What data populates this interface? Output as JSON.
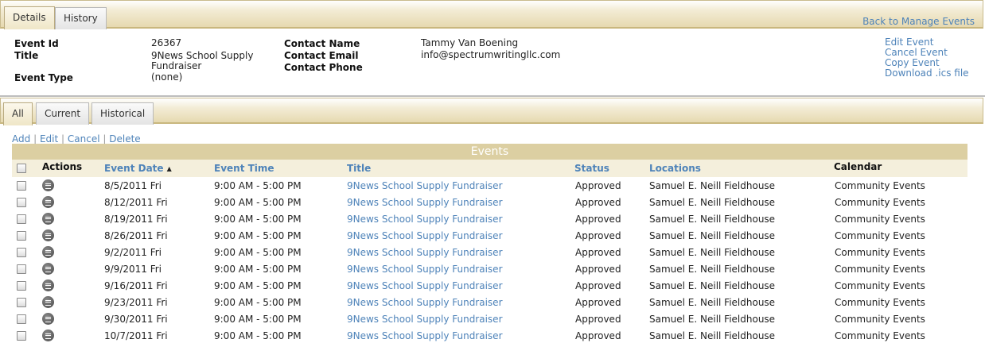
{
  "top_tabs": [
    {
      "label": "Details",
      "active": true
    },
    {
      "label": "History",
      "active": false
    }
  ],
  "back_link": "Back to Manage Events",
  "details": {
    "event_id_label": "Event Id",
    "event_id": "26367",
    "title_label": "Title",
    "title_line1": "9News School Supply",
    "title_line2": "Fundraiser",
    "event_type_label": "Event Type",
    "event_type": "(none)",
    "contact_name_label": "Contact Name",
    "contact_name": "Tammy Van Boening",
    "contact_email_label": "Contact Email",
    "contact_email": "info@spectrumwritingllc.com",
    "contact_phone_label": "Contact Phone",
    "contact_phone": ""
  },
  "side_links": [
    "Edit Event",
    "Cancel Event",
    "Copy Event",
    "Download .ics file"
  ],
  "list_tabs": [
    {
      "label": "All",
      "active": true
    },
    {
      "label": "Current",
      "active": false
    },
    {
      "label": "Historical",
      "active": false
    }
  ],
  "grid_actions": {
    "add": "Add",
    "edit": "Edit",
    "cancel": "Cancel",
    "delete": "Delete",
    "separator": "|"
  },
  "grid": {
    "title": "Events",
    "headers": {
      "actions": "Actions",
      "event_date": "Event Date",
      "event_time": "Event Time",
      "title": "Title",
      "status": "Status",
      "locations": "Locations",
      "calendar": "Calendar"
    },
    "sort_indicator": "▲",
    "rows": [
      {
        "date": "8/5/2011 Fri",
        "time": "9:00 AM - 5:00 PM",
        "title": "9News School Supply Fundraiser",
        "status": "Approved",
        "location": "Samuel E. Neill Fieldhouse",
        "calendar": "Community Events"
      },
      {
        "date": "8/12/2011 Fri",
        "time": "9:00 AM - 5:00 PM",
        "title": "9News School Supply Fundraiser",
        "status": "Approved",
        "location": "Samuel E. Neill Fieldhouse",
        "calendar": "Community Events"
      },
      {
        "date": "8/19/2011 Fri",
        "time": "9:00 AM - 5:00 PM",
        "title": "9News School Supply Fundraiser",
        "status": "Approved",
        "location": "Samuel E. Neill Fieldhouse",
        "calendar": "Community Events"
      },
      {
        "date": "8/26/2011 Fri",
        "time": "9:00 AM - 5:00 PM",
        "title": "9News School Supply Fundraiser",
        "status": "Approved",
        "location": "Samuel E. Neill Fieldhouse",
        "calendar": "Community Events"
      },
      {
        "date": "9/2/2011 Fri",
        "time": "9:00 AM - 5:00 PM",
        "title": "9News School Supply Fundraiser",
        "status": "Approved",
        "location": "Samuel E. Neill Fieldhouse",
        "calendar": "Community Events"
      },
      {
        "date": "9/9/2011 Fri",
        "time": "9:00 AM - 5:00 PM",
        "title": "9News School Supply Fundraiser",
        "status": "Approved",
        "location": "Samuel E. Neill Fieldhouse",
        "calendar": "Community Events"
      },
      {
        "date": "9/16/2011 Fri",
        "time": "9:00 AM - 5:00 PM",
        "title": "9News School Supply Fundraiser",
        "status": "Approved",
        "location": "Samuel E. Neill Fieldhouse",
        "calendar": "Community Events"
      },
      {
        "date": "9/23/2011 Fri",
        "time": "9:00 AM - 5:00 PM",
        "title": "9News School Supply Fundraiser",
        "status": "Approved",
        "location": "Samuel E. Neill Fieldhouse",
        "calendar": "Community Events"
      },
      {
        "date": "9/30/2011 Fri",
        "time": "9:00 AM - 5:00 PM",
        "title": "9News School Supply Fundraiser",
        "status": "Approved",
        "location": "Samuel E. Neill Fieldhouse",
        "calendar": "Community Events"
      },
      {
        "date": "10/7/2011 Fri",
        "time": "9:00 AM - 5:00 PM",
        "title": "9News School Supply Fundraiser",
        "status": "Approved",
        "location": "Samuel E. Neill Fieldhouse",
        "calendar": "Community Events"
      }
    ]
  },
  "colors": {
    "link": "#4e83b9",
    "tab_strip": "#e6d9b0",
    "grid_title_bg": "#dccfa2",
    "grid_header_bg": "#f4efdc"
  }
}
